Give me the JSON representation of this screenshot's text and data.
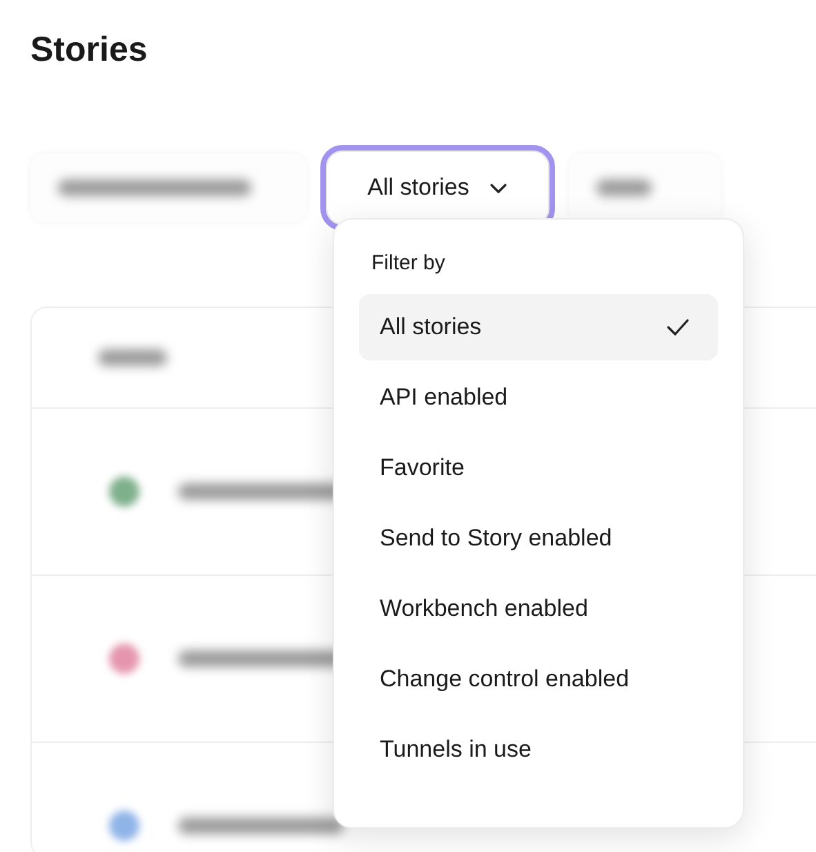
{
  "page": {
    "title": "Stories"
  },
  "filter_button": {
    "label": "All stories",
    "focused": true
  },
  "menu": {
    "heading": "Filter by",
    "items": [
      {
        "label": "All stories",
        "selected": true
      },
      {
        "label": "API enabled",
        "selected": false
      },
      {
        "label": "Favorite",
        "selected": false
      },
      {
        "label": "Send to Story enabled",
        "selected": false
      },
      {
        "label": "Workbench enabled",
        "selected": false
      },
      {
        "label": "Change control enabled",
        "selected": false
      },
      {
        "label": "Tunnels in use",
        "selected": false
      }
    ]
  },
  "table_rows": [
    {
      "color": "#7fb08c"
    },
    {
      "color": "#e596ae"
    },
    {
      "color": "#8fb4e8"
    }
  ]
}
